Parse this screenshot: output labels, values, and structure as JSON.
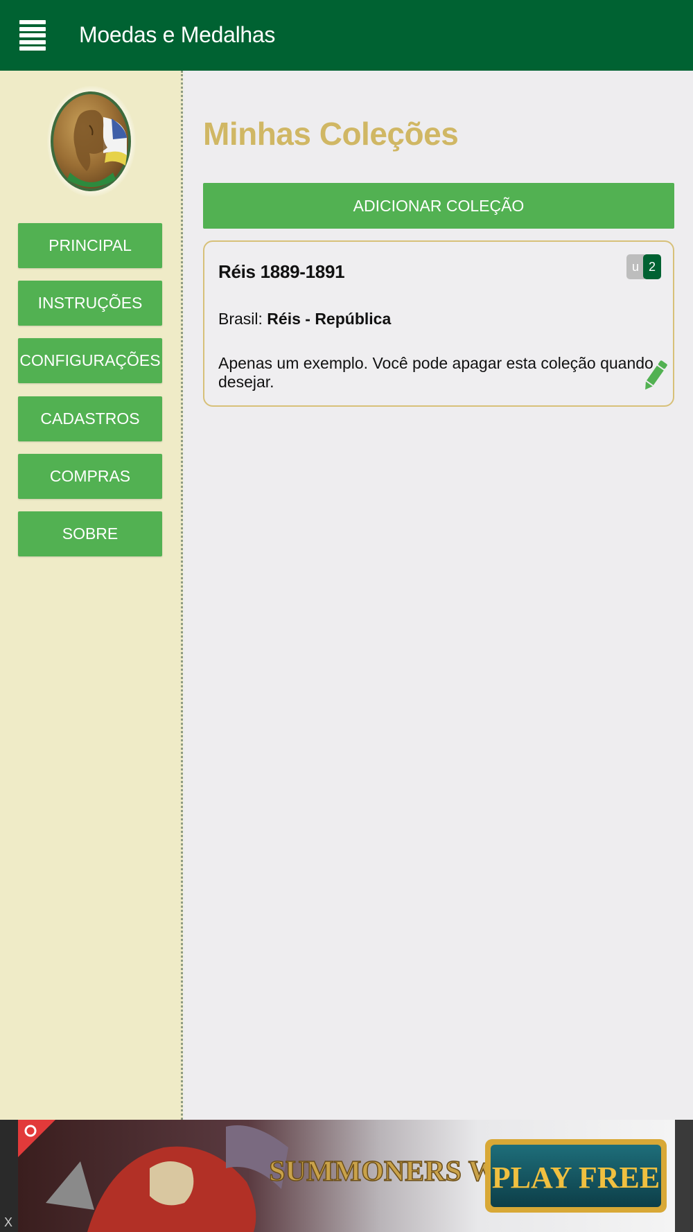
{
  "header": {
    "title": "Moedas e Medalhas",
    "menu_icon": "hamburger-menu-icon"
  },
  "sidebar": {
    "logo": "medal-logo",
    "items": [
      {
        "label": "PRINCIPAL"
      },
      {
        "label": "INSTRUÇÕES"
      },
      {
        "label": "CONFIGURAÇÕES"
      },
      {
        "label": "CADASTROS"
      },
      {
        "label": "COMPRAS"
      },
      {
        "label": "SOBRE"
      }
    ]
  },
  "main": {
    "title": "Minhas Coleções",
    "add_button": "ADICIONAR COLEÇÃO",
    "collections": [
      {
        "name": "Réis 1889-1891",
        "badge_u": "u",
        "badge_count": "2",
        "country_label": "Brasil: ",
        "series": "Réis - República",
        "description": "Apenas um exemplo. Você pode apagar esta coleção quando desejar.",
        "edit_icon": "pencil-icon"
      }
    ]
  },
  "ad": {
    "close": "X",
    "brand": "SUMMONERS WAR",
    "cta": "PLAY FREE"
  },
  "colors": {
    "topbar": "#006232",
    "button": "#52b152",
    "title_gold": "#d0b764",
    "sidebar_bg": "#efebc7"
  }
}
